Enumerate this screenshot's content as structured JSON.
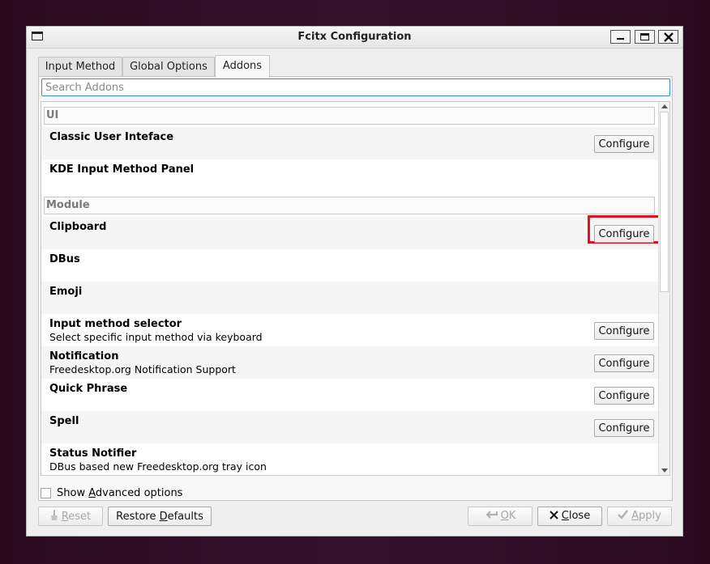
{
  "window": {
    "title": "Fcitx Configuration"
  },
  "tabs": [
    {
      "label": "Input Method",
      "active": false
    },
    {
      "label": "Global Options",
      "active": false
    },
    {
      "label": "Addons",
      "active": true
    }
  ],
  "search": {
    "placeholder": "Search Addons",
    "value": ""
  },
  "sections": [
    {
      "title": "UI",
      "items": [
        {
          "name": "Classic User Inteface",
          "description": "",
          "configure": true
        },
        {
          "name": "KDE Input Method Panel",
          "description": "",
          "configure": false
        }
      ]
    },
    {
      "title": "Module",
      "items": [
        {
          "name": "Clipboard",
          "description": "",
          "configure": true,
          "highlighted": true
        },
        {
          "name": "DBus",
          "description": "",
          "configure": false
        },
        {
          "name": "Emoji",
          "description": "",
          "configure": false
        },
        {
          "name": "Input method selector",
          "description": "Select specific input method via keyboard",
          "configure": true
        },
        {
          "name": "Notification",
          "description": "Freedesktop.org Notification Support",
          "configure": true
        },
        {
          "name": "Quick Phrase",
          "description": "",
          "configure": true
        },
        {
          "name": "Spell",
          "description": "",
          "configure": true
        },
        {
          "name": "Status Notifier",
          "description": "DBus based new Freedesktop.org tray icon",
          "configure": false
        }
      ]
    }
  ],
  "configure_label": "Configure",
  "advanced": {
    "prefix": "Show ",
    "mnemonic": "A",
    "suffix": "dvanced options",
    "checked": false
  },
  "buttons": {
    "reset": {
      "mnemonic": "R",
      "rest": "eset",
      "enabled": false
    },
    "restore_defaults": {
      "prefix": "Restore ",
      "mnemonic": "D",
      "rest": "efaults",
      "enabled": true
    },
    "ok": {
      "mnemonic": "O",
      "rest": "K",
      "enabled": false
    },
    "close": {
      "mnemonic": "C",
      "rest": "lose",
      "enabled": true
    },
    "apply": {
      "mnemonic": "A",
      "rest": "pply",
      "enabled": false
    }
  },
  "colors": {
    "highlight": "#e0141e",
    "focus": "#3d8ee0",
    "background": "#2c0a1e"
  }
}
